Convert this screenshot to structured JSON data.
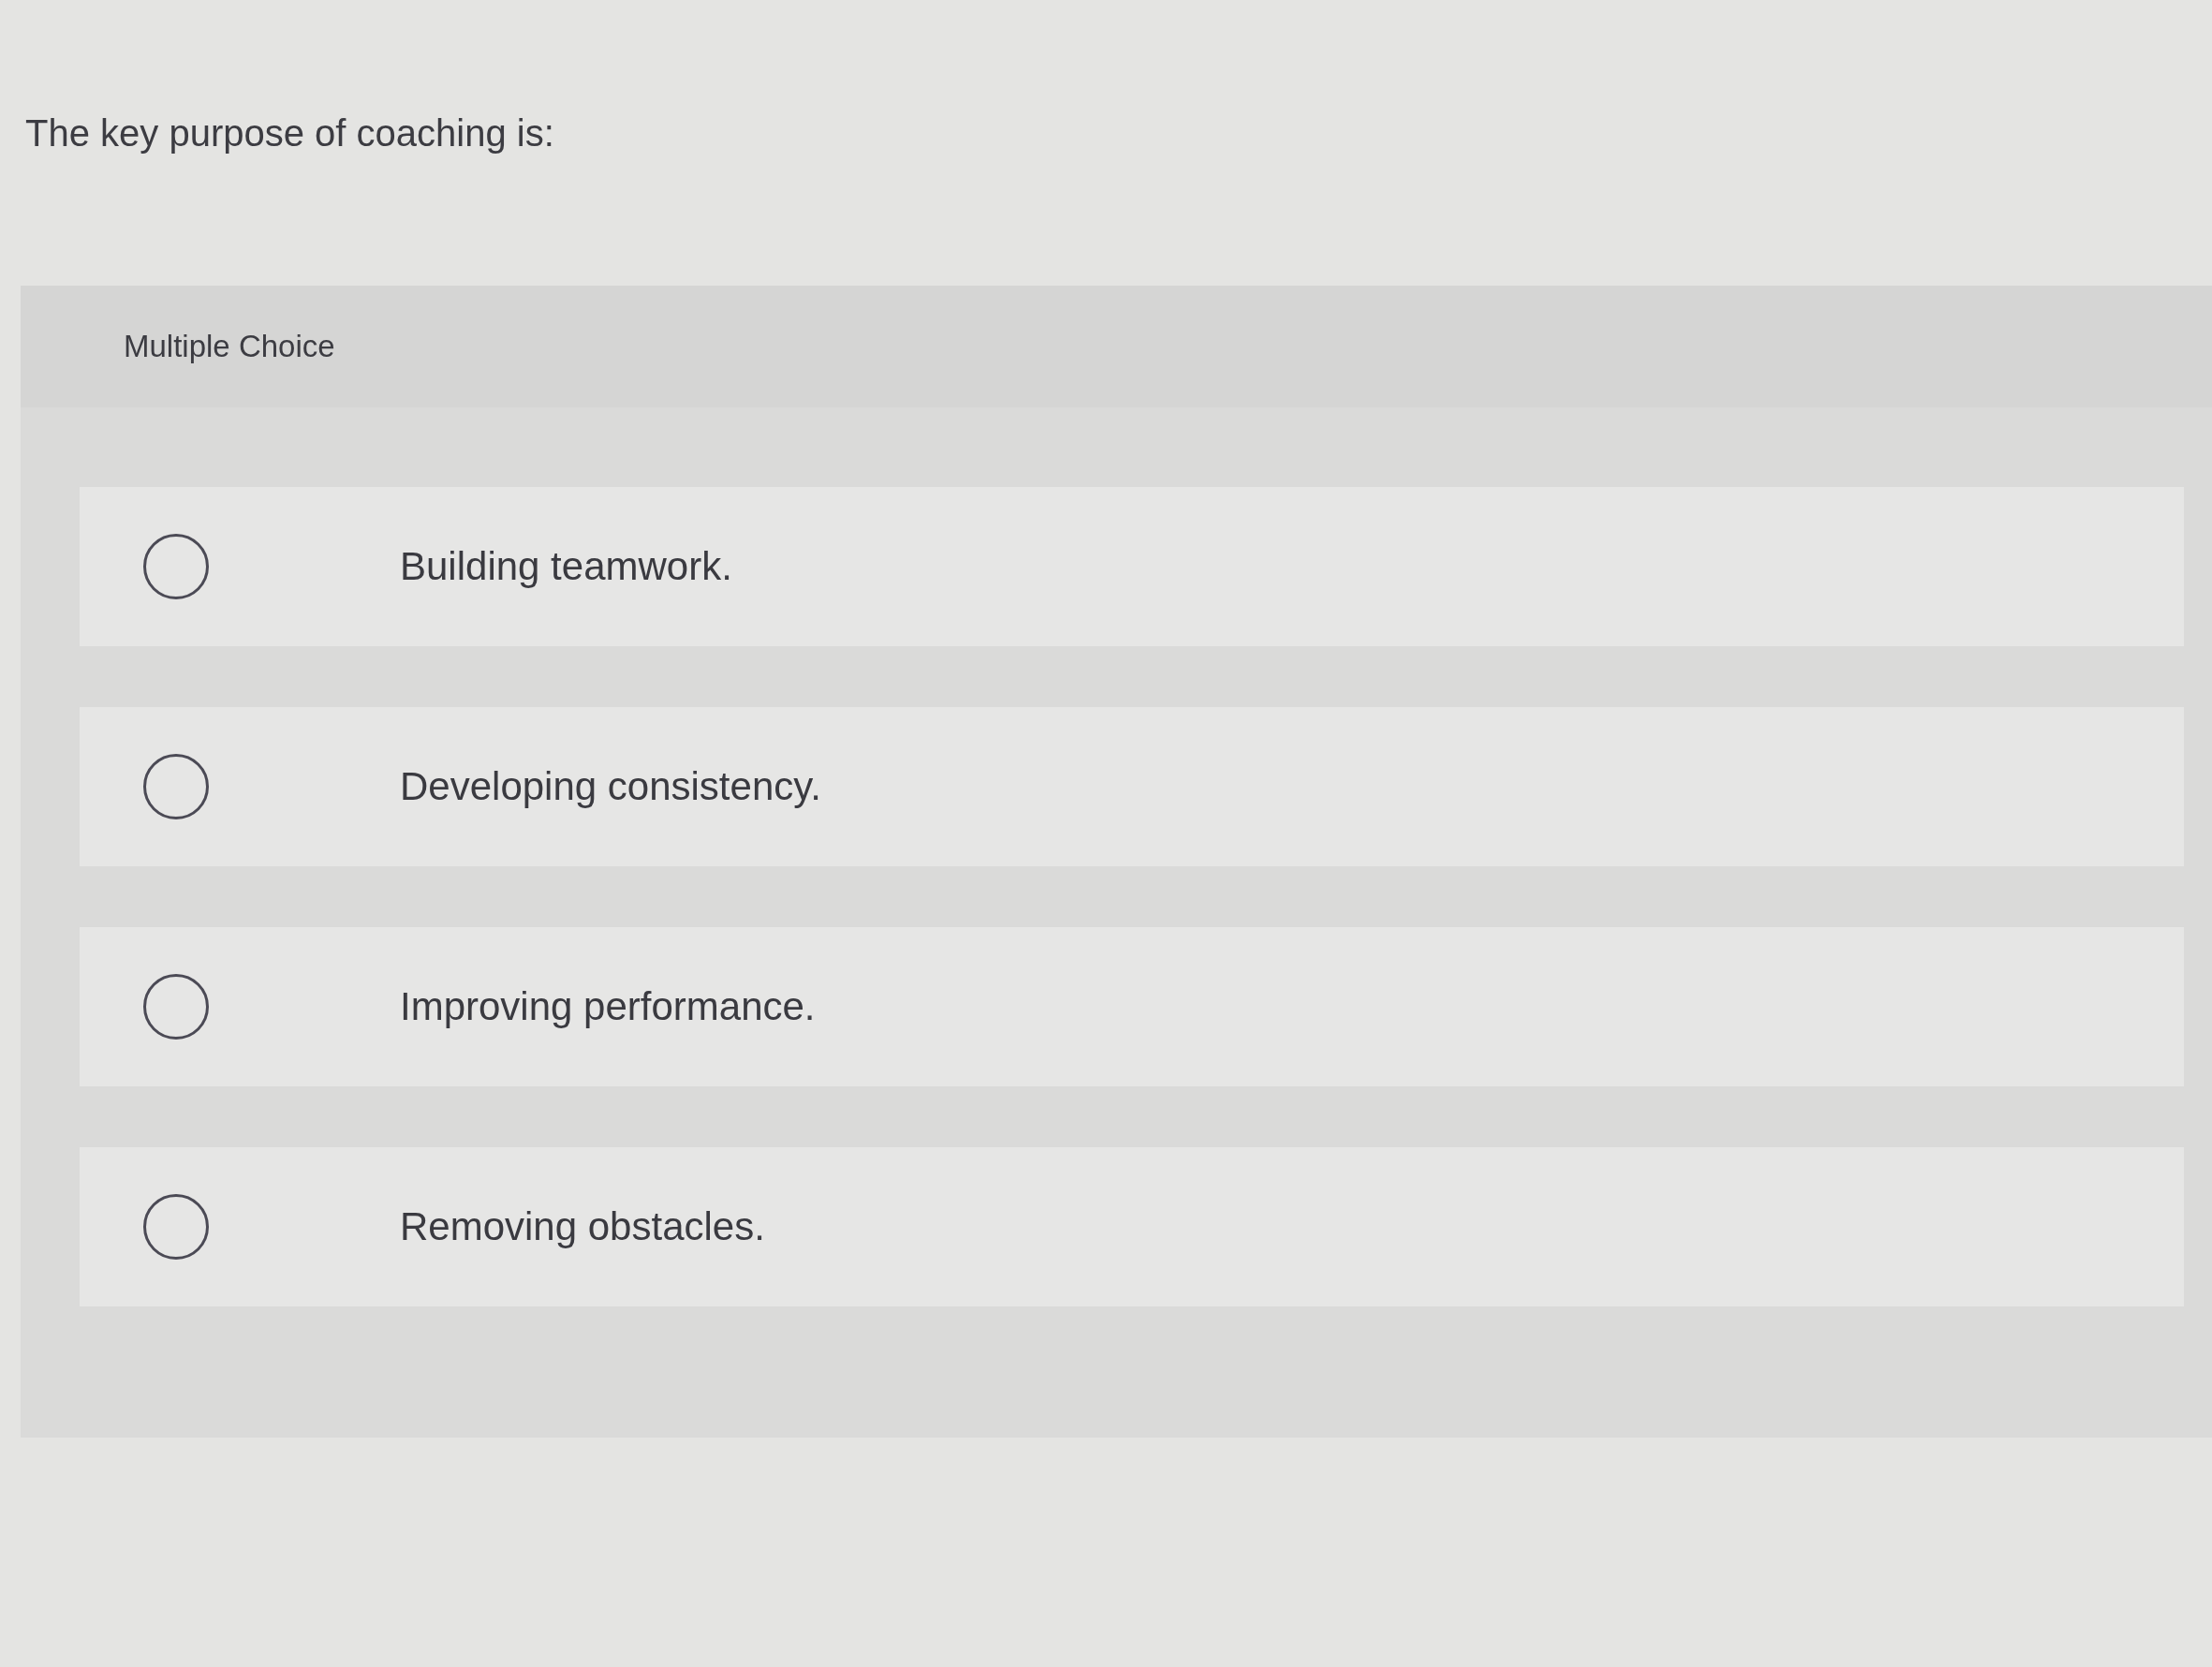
{
  "question": "The key purpose of coaching is:",
  "question_type": "Multiple Choice",
  "options": [
    {
      "label": "Building teamwork.",
      "selected": false
    },
    {
      "label": "Developing consistency.",
      "selected": false
    },
    {
      "label": "Improving performance.",
      "selected": false
    },
    {
      "label": "Removing obstacles.",
      "selected": false
    }
  ]
}
